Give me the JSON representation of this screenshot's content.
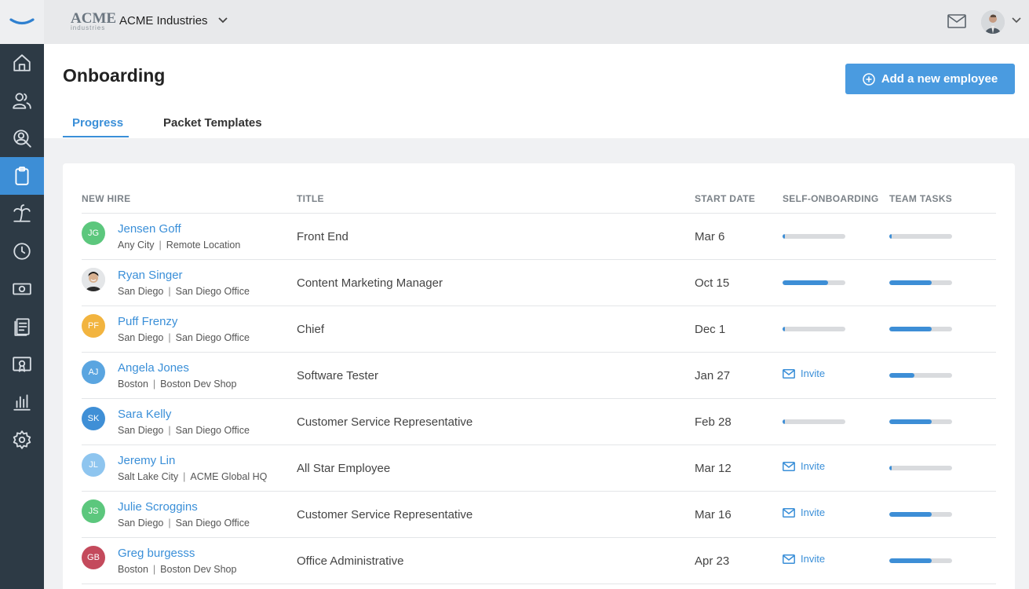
{
  "header": {
    "brand": "ACME",
    "brand_sub": "industries",
    "company": "ACME Industries"
  },
  "page": {
    "title": "Onboarding",
    "add_button": "Add a new employee",
    "tabs": [
      {
        "label": "Progress",
        "active": true
      },
      {
        "label": "Packet Templates",
        "active": false
      }
    ]
  },
  "table": {
    "columns": [
      "NEW HIRE",
      "TITLE",
      "START DATE",
      "SELF-ONBOARDING",
      "TEAM TASKS"
    ],
    "invite_label": "Invite",
    "rows": [
      {
        "initials": "JG",
        "avatar_color": "#5cc77d",
        "name": "Jensen Goff",
        "city": "Any City",
        "office": "Remote Location",
        "title": "Front End",
        "start": "Mar 6",
        "self": 0.02,
        "team": 0.02
      },
      {
        "initials": "",
        "avatar_color": "#cfd3d6",
        "photo": true,
        "name": "Ryan Singer",
        "city": "San Diego",
        "office": "San Diego Office",
        "title": "Content Marketing Manager",
        "start": "Oct 15",
        "self": 0.72,
        "team": 0.68
      },
      {
        "initials": "PF",
        "avatar_color": "#f2b43f",
        "name": "Puff Frenzy",
        "city": "San Diego",
        "office": "San Diego Office",
        "title": "Chief",
        "start": "Dec 1",
        "self": 0.02,
        "team": 0.68
      },
      {
        "initials": "AJ",
        "avatar_color": "#5aa5e0",
        "name": "Angela Jones",
        "city": "Boston",
        "office": "Boston Dev Shop",
        "title": "Software Tester",
        "start": "Jan 27",
        "self": null,
        "team": 0.4
      },
      {
        "initials": "SK",
        "avatar_color": "#3f8fd6",
        "name": "Sara Kelly",
        "city": "San Diego",
        "office": "San Diego Office",
        "title": "Customer Service Representative",
        "start": "Feb 28",
        "self": 0.02,
        "team": 0.68
      },
      {
        "initials": "JL",
        "avatar_color": "#8ec5ef",
        "name": "Jeremy Lin",
        "city": "Salt Lake City",
        "office": "ACME Global HQ",
        "title": "All Star Employee",
        "start": "Mar 12",
        "self": null,
        "team": 0.02
      },
      {
        "initials": "JS",
        "avatar_color": "#5cc77d",
        "name": "Julie Scroggins",
        "city": "San Diego",
        "office": "San Diego Office",
        "title": "Customer Service Representative",
        "start": "Mar 16",
        "self": null,
        "team": 0.68
      },
      {
        "initials": "GB",
        "avatar_color": "#c44a5c",
        "name": "Greg burgesss",
        "city": "Boston",
        "office": "Boston Dev Shop",
        "title": "Office Administrative",
        "start": "Apr 23",
        "self": null,
        "team": 0.68
      }
    ]
  },
  "sidebar": {
    "items": [
      {
        "icon": "home-icon",
        "active": false
      },
      {
        "icon": "people-icon",
        "active": false
      },
      {
        "icon": "person-search-icon",
        "active": false
      },
      {
        "icon": "clipboard-icon",
        "active": true
      },
      {
        "icon": "palm-tree-icon",
        "active": false
      },
      {
        "icon": "clock-icon",
        "active": false
      },
      {
        "icon": "money-icon",
        "active": false
      },
      {
        "icon": "documents-icon",
        "active": false
      },
      {
        "icon": "certificate-icon",
        "active": false
      },
      {
        "icon": "chart-icon",
        "active": false
      },
      {
        "icon": "gear-icon",
        "active": false
      }
    ]
  },
  "colors": {
    "accent": "#3d8ed6",
    "sidebar": "#2d3a45"
  }
}
